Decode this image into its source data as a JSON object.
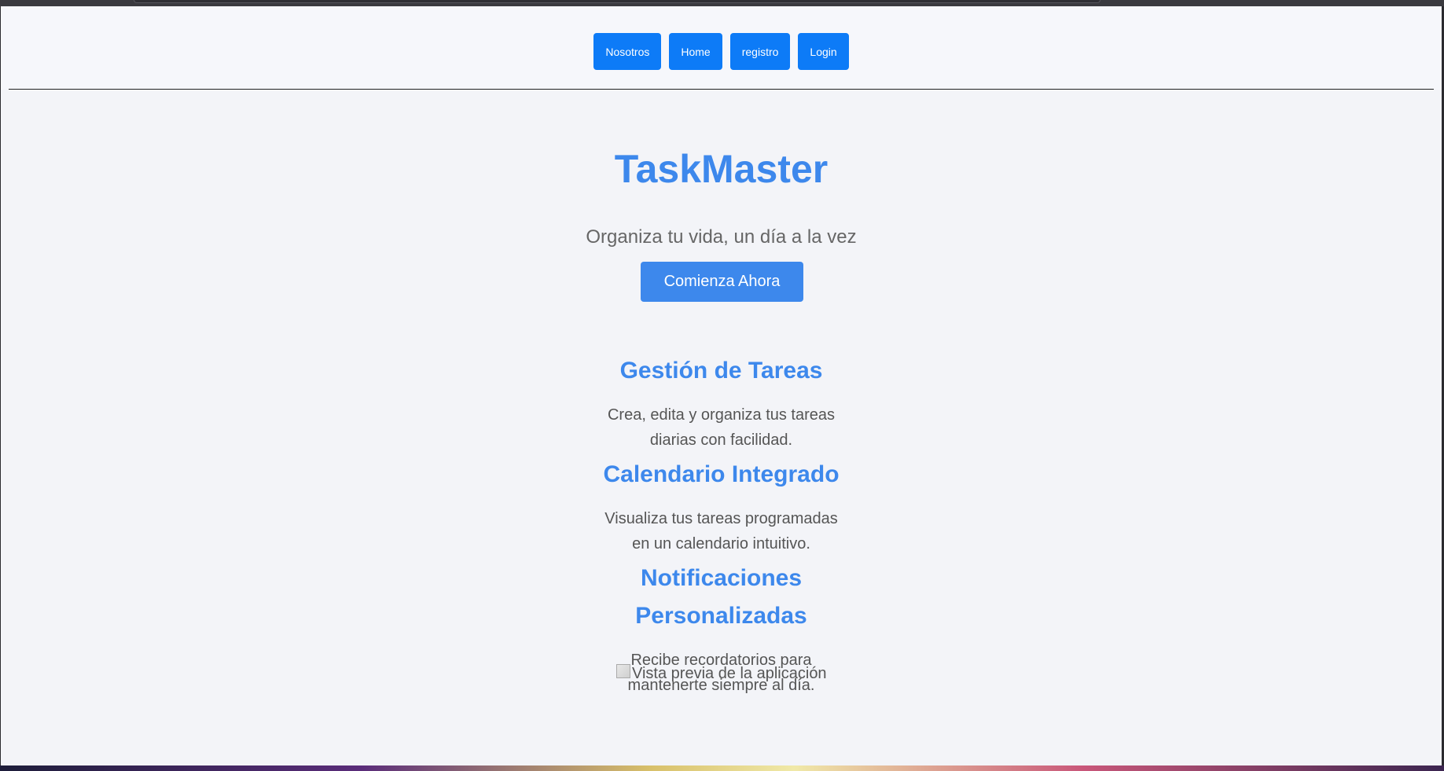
{
  "nav": {
    "buttons": [
      {
        "label": "Nosotros"
      },
      {
        "label": "Home"
      },
      {
        "label": "registro"
      },
      {
        "label": "Login"
      }
    ]
  },
  "hero": {
    "title": "TaskMaster",
    "tagline": "Organiza tu vida, un día a la vez",
    "cta_label": "Comienza Ahora"
  },
  "features": [
    {
      "title": "Gestión de Tareas",
      "desc_line1": "Crea, edita y organiza tus tareas",
      "desc_line2": "diarias con facilidad."
    },
    {
      "title": "Calendario Integrado",
      "desc_line1": "Visualiza tus tareas programadas",
      "desc_line2": "en un calendario intuitivo."
    },
    {
      "title_line1": "Notificaciones",
      "title_line2": "Personalizadas",
      "desc_line1": "Recibe recordatorios para",
      "desc_line2": "mantenerte siempre al día."
    }
  ],
  "preview_alt": "Vista previa de la aplicación",
  "colors": {
    "nav_button": "#0d7bf7",
    "accent": "#3d88ec",
    "page_bg": "#f3f4f8"
  }
}
